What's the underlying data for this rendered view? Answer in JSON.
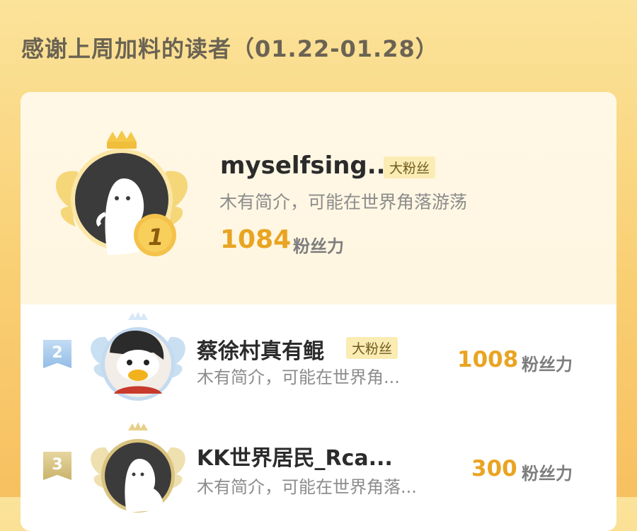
{
  "title": "感谢上周加料的读者（01.22-01.28）",
  "accent_color": "#e9a422",
  "top_reader": {
    "rank": "1",
    "name": "myselfsing...",
    "tag": "大粉丝",
    "bio": "木有简介，可能在世界角落游荡",
    "score": "1084",
    "unit": "粉丝力"
  },
  "readers": [
    {
      "rank": "2",
      "name": "蔡徐村真有鲲",
      "tag": "大粉丝",
      "bio": "木有简介，可能在世界角...",
      "score": "1008",
      "unit": "粉丝力"
    },
    {
      "rank": "3",
      "name": "KK世界居民_Rca...",
      "bio": "木有简介，可能在世界角落...",
      "score": "300",
      "unit": "粉丝力"
    }
  ]
}
